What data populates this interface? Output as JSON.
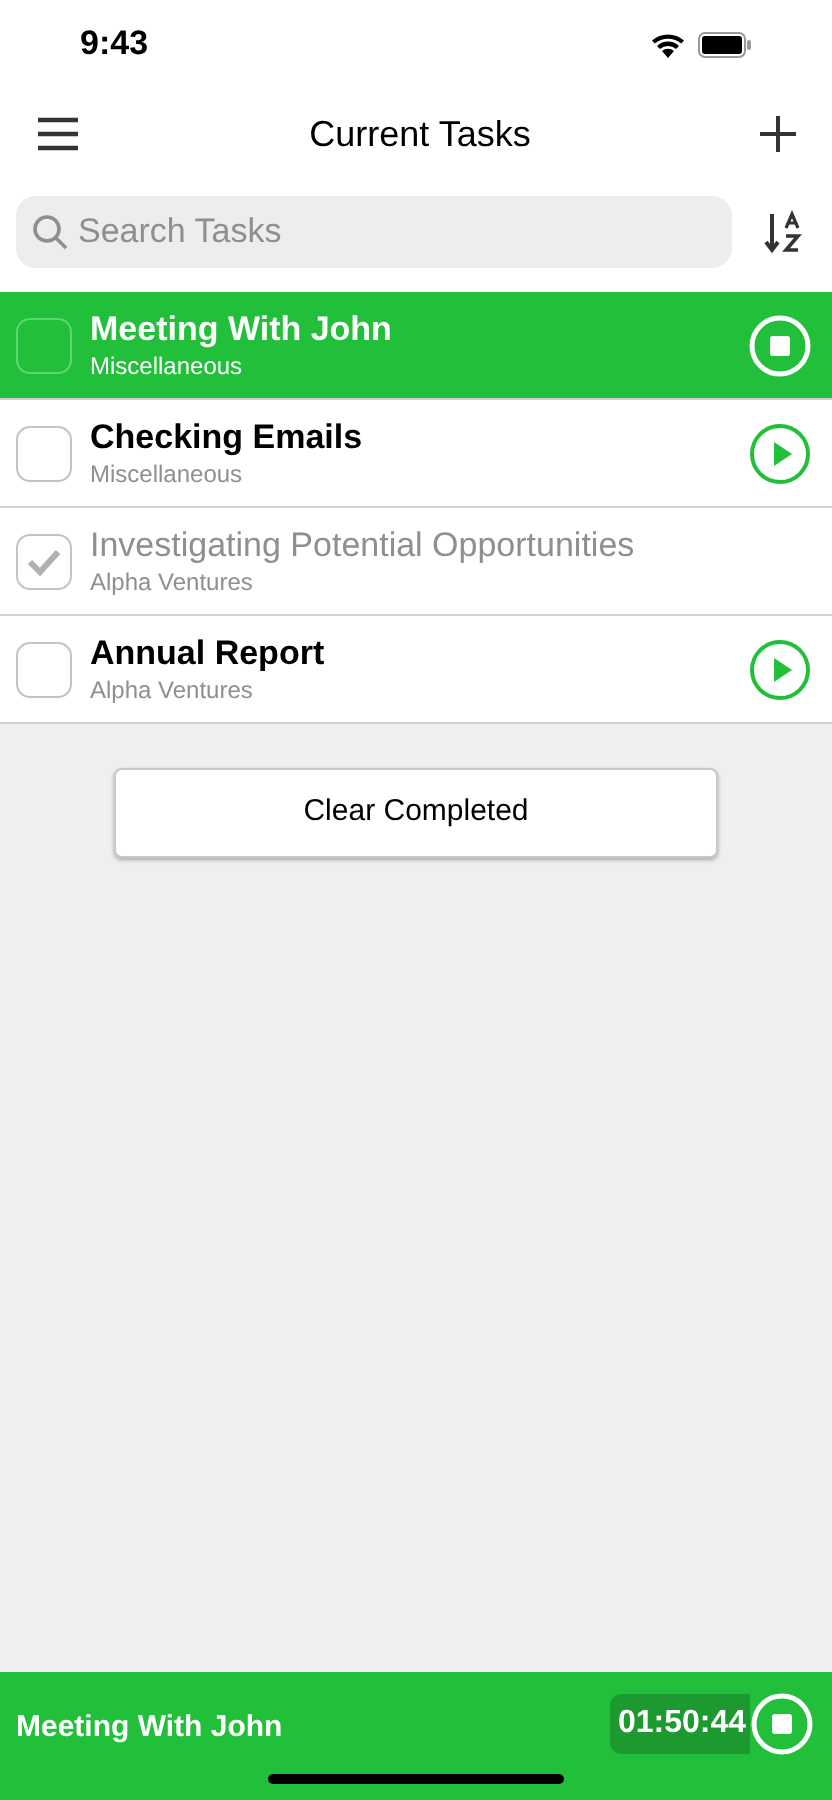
{
  "status_bar": {
    "time": "9:43"
  },
  "nav": {
    "title": "Current Tasks"
  },
  "search": {
    "placeholder": "Search Tasks"
  },
  "tasks": [
    {
      "title": "Meeting With John",
      "category": "Miscellaneous",
      "checked": false,
      "selected": true,
      "kind": "stop"
    },
    {
      "title": "Checking Emails",
      "category": "Miscellaneous",
      "checked": false,
      "selected": false,
      "kind": "play"
    },
    {
      "title": "Investigating Potential Opportunities",
      "category": "Alpha Ventures",
      "checked": true,
      "selected": false,
      "kind": "none"
    },
    {
      "title": "Annual Report",
      "category": "Alpha Ventures",
      "checked": false,
      "selected": false,
      "kind": "play"
    }
  ],
  "clear_button": "Clear Completed",
  "timer_bar": {
    "task": "Meeting With John",
    "elapsed": "01:50:44"
  }
}
